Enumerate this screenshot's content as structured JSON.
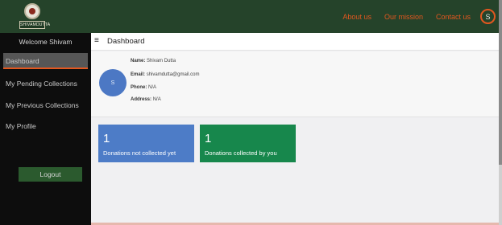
{
  "brand": {
    "logo_text": "SHIVAMDUTTA",
    "logo_icon": "emblem-icon"
  },
  "nav": {
    "links": [
      "About us",
      "Our mission",
      "Contact us"
    ],
    "avatar_initial": "S"
  },
  "sidebar": {
    "welcome": "Welcome Shivam",
    "items": [
      {
        "label": "Dashboard",
        "active": true
      },
      {
        "label": "My Pending Collections",
        "active": false
      },
      {
        "label": "My Previous Collections",
        "active": false
      },
      {
        "label": "My Profile",
        "active": false
      }
    ],
    "logout_label": "Logout"
  },
  "header": {
    "menu_icon": "hamburger-icon",
    "menu_glyph": "≡",
    "title": "Dashboard"
  },
  "profile": {
    "avatar_initial": "S",
    "name_label": "Name:",
    "name": "Shivam Dutta",
    "email_label": "Email:",
    "email": "shivamdutta@gmail.com",
    "phone_label": "Phone:",
    "phone": "N/A",
    "address_label": "Address:",
    "address": "N/A"
  },
  "stats": [
    {
      "value": "1",
      "label": "Donations not collected yet",
      "color": "#4d7cc7"
    },
    {
      "value": "1",
      "label": "Donations collected by you",
      "color": "#17874c"
    }
  ],
  "colors": {
    "topbar": "#25432a",
    "sidebar": "#0d0d0d",
    "accent": "#e2571f",
    "logout": "#2b5a2e"
  }
}
